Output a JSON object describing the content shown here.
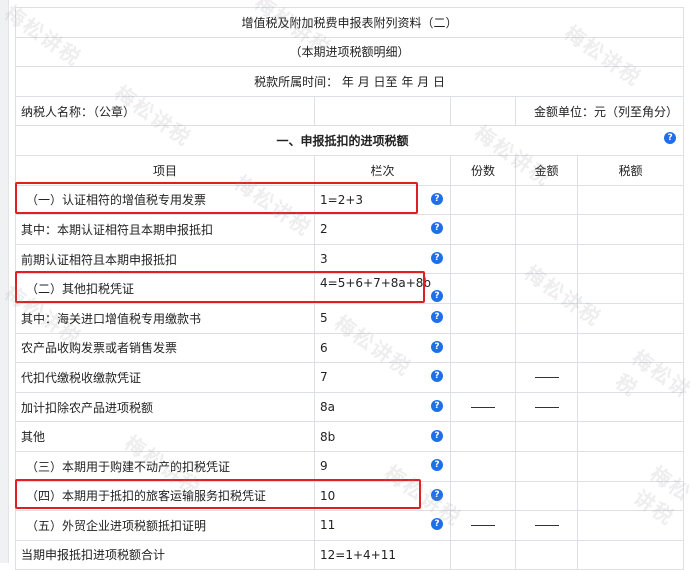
{
  "title": "增值税及附加税费申报表附列资料（二）",
  "subtitle": "（本期进项税额明细）",
  "period": "税款所属时间：  年 月 日至 年 月 日",
  "taxpayer": "纳税人名称：（公章）",
  "unit": "金额单位：元（列至角分）",
  "section": "一、申报抵扣的进项税额",
  "headers": [
    "项目",
    "栏次",
    "份数",
    "金额",
    "税额"
  ],
  "rows": [
    {
      "item": "（一）认证相符的增值税专用发票",
      "col": "1=2+3",
      "dash_count": false,
      "dash_amount": false
    },
    {
      "item": "其中：本期认证相符且本期申报抵扣",
      "col": "2",
      "dash_count": false,
      "dash_amount": false
    },
    {
      "item": "前期认证相符且本期申报抵扣",
      "col": "3",
      "dash_count": false,
      "dash_amount": false
    },
    {
      "item": "（二）其他扣税凭证",
      "col": "4=5+6+7+8a+8b",
      "dash_count": false,
      "dash_amount": false
    },
    {
      "item": "其中：海关进口增值税专用缴款书",
      "col": "5",
      "dash_count": false,
      "dash_amount": false
    },
    {
      "item": "农产品收购发票或者销售发票",
      "col": "6",
      "dash_count": false,
      "dash_amount": false
    },
    {
      "item": "代扣代缴税收缴款凭证",
      "col": "7",
      "dash_count": false,
      "dash_amount": true
    },
    {
      "item": "加计扣除农产品进项税额",
      "col": "8a",
      "dash_count": true,
      "dash_amount": true
    },
    {
      "item": "其他",
      "col": "8b",
      "dash_count": false,
      "dash_amount": false
    },
    {
      "item": "（三）本期用于购建不动产的扣税凭证",
      "col": "9",
      "dash_count": false,
      "dash_amount": false
    },
    {
      "item": "（四）本期用于抵扣的旅客运输服务扣税凭证",
      "col": "10",
      "dash_count": false,
      "dash_amount": false
    },
    {
      "item": "（五）外贸企业进项税额抵扣证明",
      "col": "11",
      "dash_count": true,
      "dash_amount": true
    },
    {
      "item": "当期申报抵扣进项税额合计",
      "col": "12=1+4+11",
      "dash_count": false,
      "dash_amount": false
    }
  ],
  "help_glyph": "?",
  "watermark": "梅松讲税",
  "highlight_color": "#e02020"
}
